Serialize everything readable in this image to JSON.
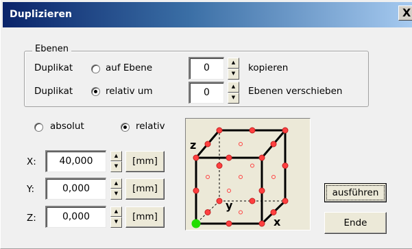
{
  "window": {
    "title": "Duplizieren",
    "close_glyph": "X"
  },
  "ebenen": {
    "legend": "Ebenen",
    "row1": {
      "label": "Duplikat",
      "option_label": "auf Ebene",
      "selected": false,
      "value": "0",
      "suffix": "kopieren"
    },
    "row2": {
      "label": "Duplikat",
      "option_label": "relativ um",
      "selected": true,
      "value": "0",
      "suffix": "Ebenen verschieben"
    }
  },
  "mode": {
    "absolut_label": "absolut",
    "absolut_selected": false,
    "relativ_label": "relativ",
    "relativ_selected": true
  },
  "coords": {
    "x": {
      "label": "X:",
      "value": "40,000",
      "unit": "[mm]"
    },
    "y": {
      "label": "Y:",
      "value": "0,000",
      "unit": "[mm]"
    },
    "z": {
      "label": "Z:",
      "value": "0,000",
      "unit": "[mm]"
    }
  },
  "preview": {
    "axis_z": "z",
    "axis_y": "y",
    "axis_x": "x",
    "colors": {
      "edge": "#000000",
      "hidden_edge": "#000000",
      "point": "#ff4040",
      "origin": "#22dd00"
    }
  },
  "buttons": {
    "execute": "ausführen",
    "end": "Ende"
  }
}
